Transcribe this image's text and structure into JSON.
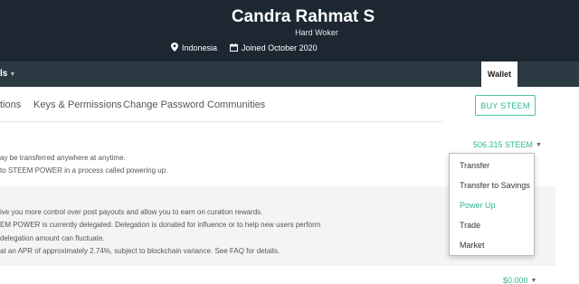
{
  "profile": {
    "name": "Candra Rahmat S",
    "tagline": "Hard Woker",
    "location": "Indonesia",
    "joined": "Joined October 2020"
  },
  "nav": {
    "left_label": "ls",
    "wallet_tab": "Wallet"
  },
  "subnav": {
    "tabs": [
      "tions",
      "Keys & Permissions",
      "Change Password",
      "Communities"
    ],
    "buy_button": "BUY STEEM"
  },
  "steem": {
    "lines": [
      "ay be transferred anywhere at anytime.",
      "to STEEM POWER in a process called powering up."
    ],
    "balance": "506.315 STEEM"
  },
  "steem_power": {
    "lines": [
      "ive you more control over post payouts and allow you to earn on curation rewards.",
      "EM POWER is currently delegated. Delegation is donated for influence or to help new users perform",
      "delegation amount can fluctuate.",
      "at an APR of approximately 2.74%, subject to blockchain variance. See FAQ for details."
    ]
  },
  "steem_dollars": {
    "balance": "$0.000"
  },
  "dropdown": {
    "items": [
      "Transfer",
      "Transfer to Savings",
      "Power Up",
      "Trade",
      "Market"
    ]
  },
  "colors": {
    "accent": "#2db896",
    "header_bg": "#1c2731",
    "nav_bg": "#2c3a44"
  }
}
